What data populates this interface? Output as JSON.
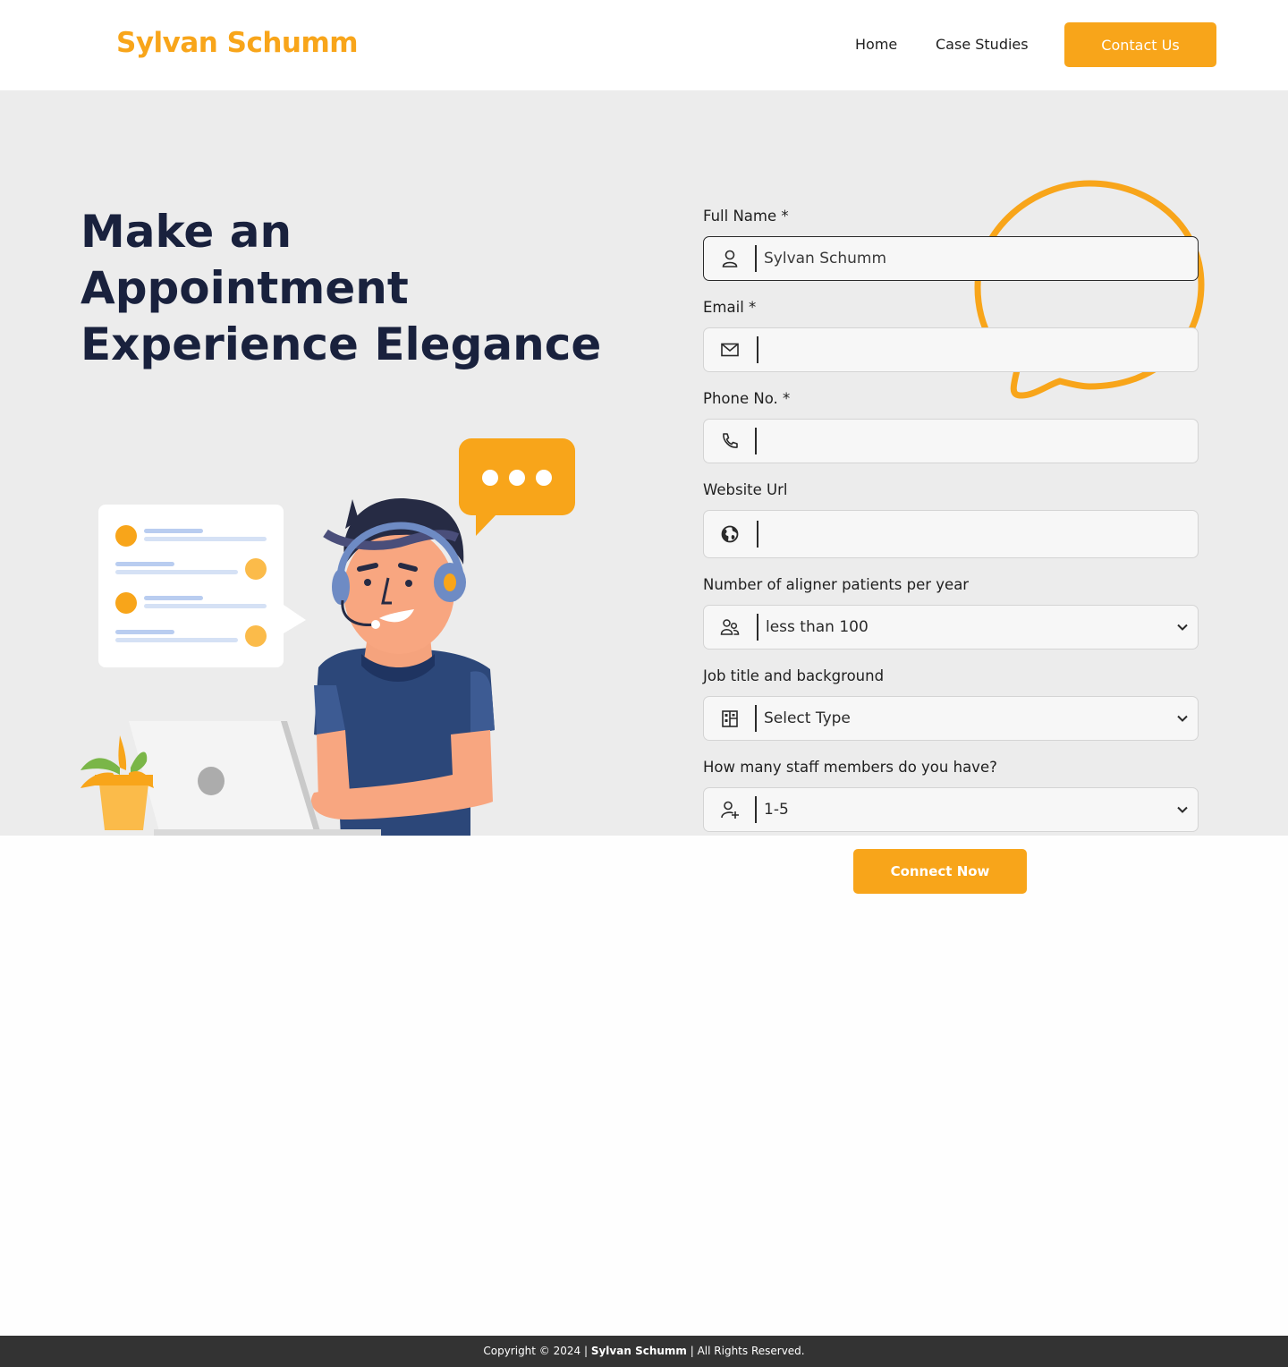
{
  "header": {
    "brand": "Sylvan Schumm",
    "nav": {
      "home": "Home",
      "case_studies": "Case Studies"
    },
    "contact_label": "Contact Us"
  },
  "hero": {
    "title_lines": [
      "Make an",
      "Appointment",
      "Experience Elegance"
    ]
  },
  "form": {
    "full_name": {
      "label": "Full Name *",
      "value": "Sylvan Schumm",
      "icon": "user-icon"
    },
    "email": {
      "label": "Email *",
      "value": "",
      "icon": "mail-icon"
    },
    "phone": {
      "label": "Phone No. *",
      "value": "",
      "icon": "phone-icon"
    },
    "website": {
      "label": "Website Url",
      "value": "",
      "icon": "globe-icon"
    },
    "patients": {
      "label": "Number of aligner patients per year",
      "selected": "less than 100",
      "icon": "users-icon"
    },
    "job": {
      "label": "Job title and background",
      "selected": "Select Type",
      "icon": "building-icon"
    },
    "staff": {
      "label": "How many staff members do you have?",
      "selected": "1-5",
      "icon": "user-plus-icon"
    },
    "submit_label": "Connect Now"
  },
  "footer": {
    "prefix": "Copyright © 2024 | ",
    "brand": "Sylvan Schumm",
    "suffix": " | All Rights Reserved."
  },
  "colors": {
    "accent": "#f8a51a",
    "title": "#19213d",
    "hero_bg": "#ececec",
    "footer_bg": "#333333"
  }
}
